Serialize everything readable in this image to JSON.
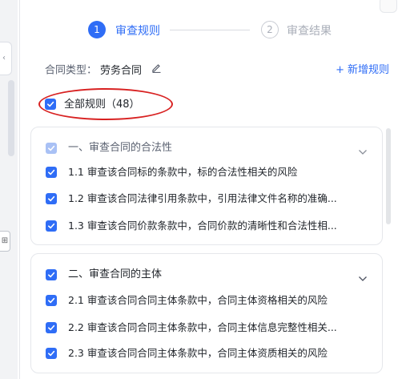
{
  "stepper": {
    "step1_num": "1",
    "step1_label": "审查规则",
    "step2_num": "2",
    "step2_label": "审查结果"
  },
  "contract": {
    "type_label": "合同类型：",
    "type_value": "劳务合同"
  },
  "add_rule_label": "新增规则",
  "all_rules_label": "全部规则（48）",
  "groups": [
    {
      "title": "一、审查合同的合法性",
      "rules": [
        "1.1 审查该合同标的条款中，标的合法性相关的风险",
        "1.2 审查该合同法律引用条款中，引用法律文件名称的准确...",
        "1.3 审查该合同价款条款中，合同价款的清晰性和合法性相..."
      ]
    },
    {
      "title": "二、审查合同的主体",
      "rules": [
        "2.1 审查该合同合同主体条款中，合同主体资格相关的风险",
        "2.2 审查该合同合同主体条款中，合同主体信息完整性相关...",
        "2.3 审查该合同合同主体条款中，合同主体资质相关的风险"
      ]
    }
  ],
  "colors": {
    "accent": "#2f6df6",
    "highlight_ellipse": "#d82121"
  },
  "icons": [
    "edit-icon",
    "plus-icon",
    "check-icon",
    "chevron-down-icon",
    "chevron-up-icon",
    "comment-icon"
  ]
}
